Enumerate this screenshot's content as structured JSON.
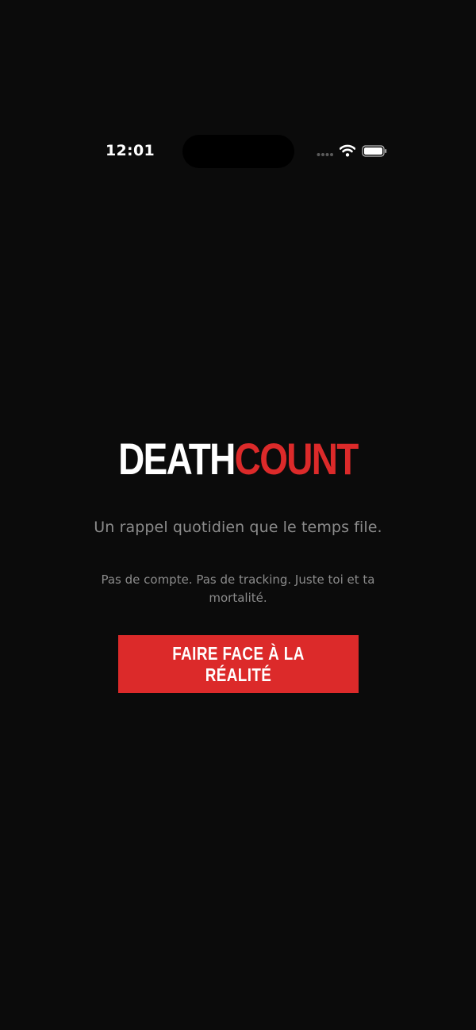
{
  "status_bar": {
    "time": "12:01",
    "icons": [
      "cellular-signal-icon",
      "wifi-icon",
      "battery-icon"
    ]
  },
  "logo": {
    "part1": "DEATH",
    "part2": "COUNT",
    "colors": {
      "part1": "#ffffff",
      "part2": "#dc2a2a"
    }
  },
  "tagline": "Un rappel quotidien que le temps file.",
  "subtext": "Pas de compte. Pas de tracking. Juste toi et ta mortalité.",
  "cta": {
    "label": "FAIRE FACE À LA RÉALITÉ",
    "color": "#dc2a2a"
  },
  "theme": {
    "background": "#0b0b0b",
    "muted_text": "#8b8b8b"
  }
}
